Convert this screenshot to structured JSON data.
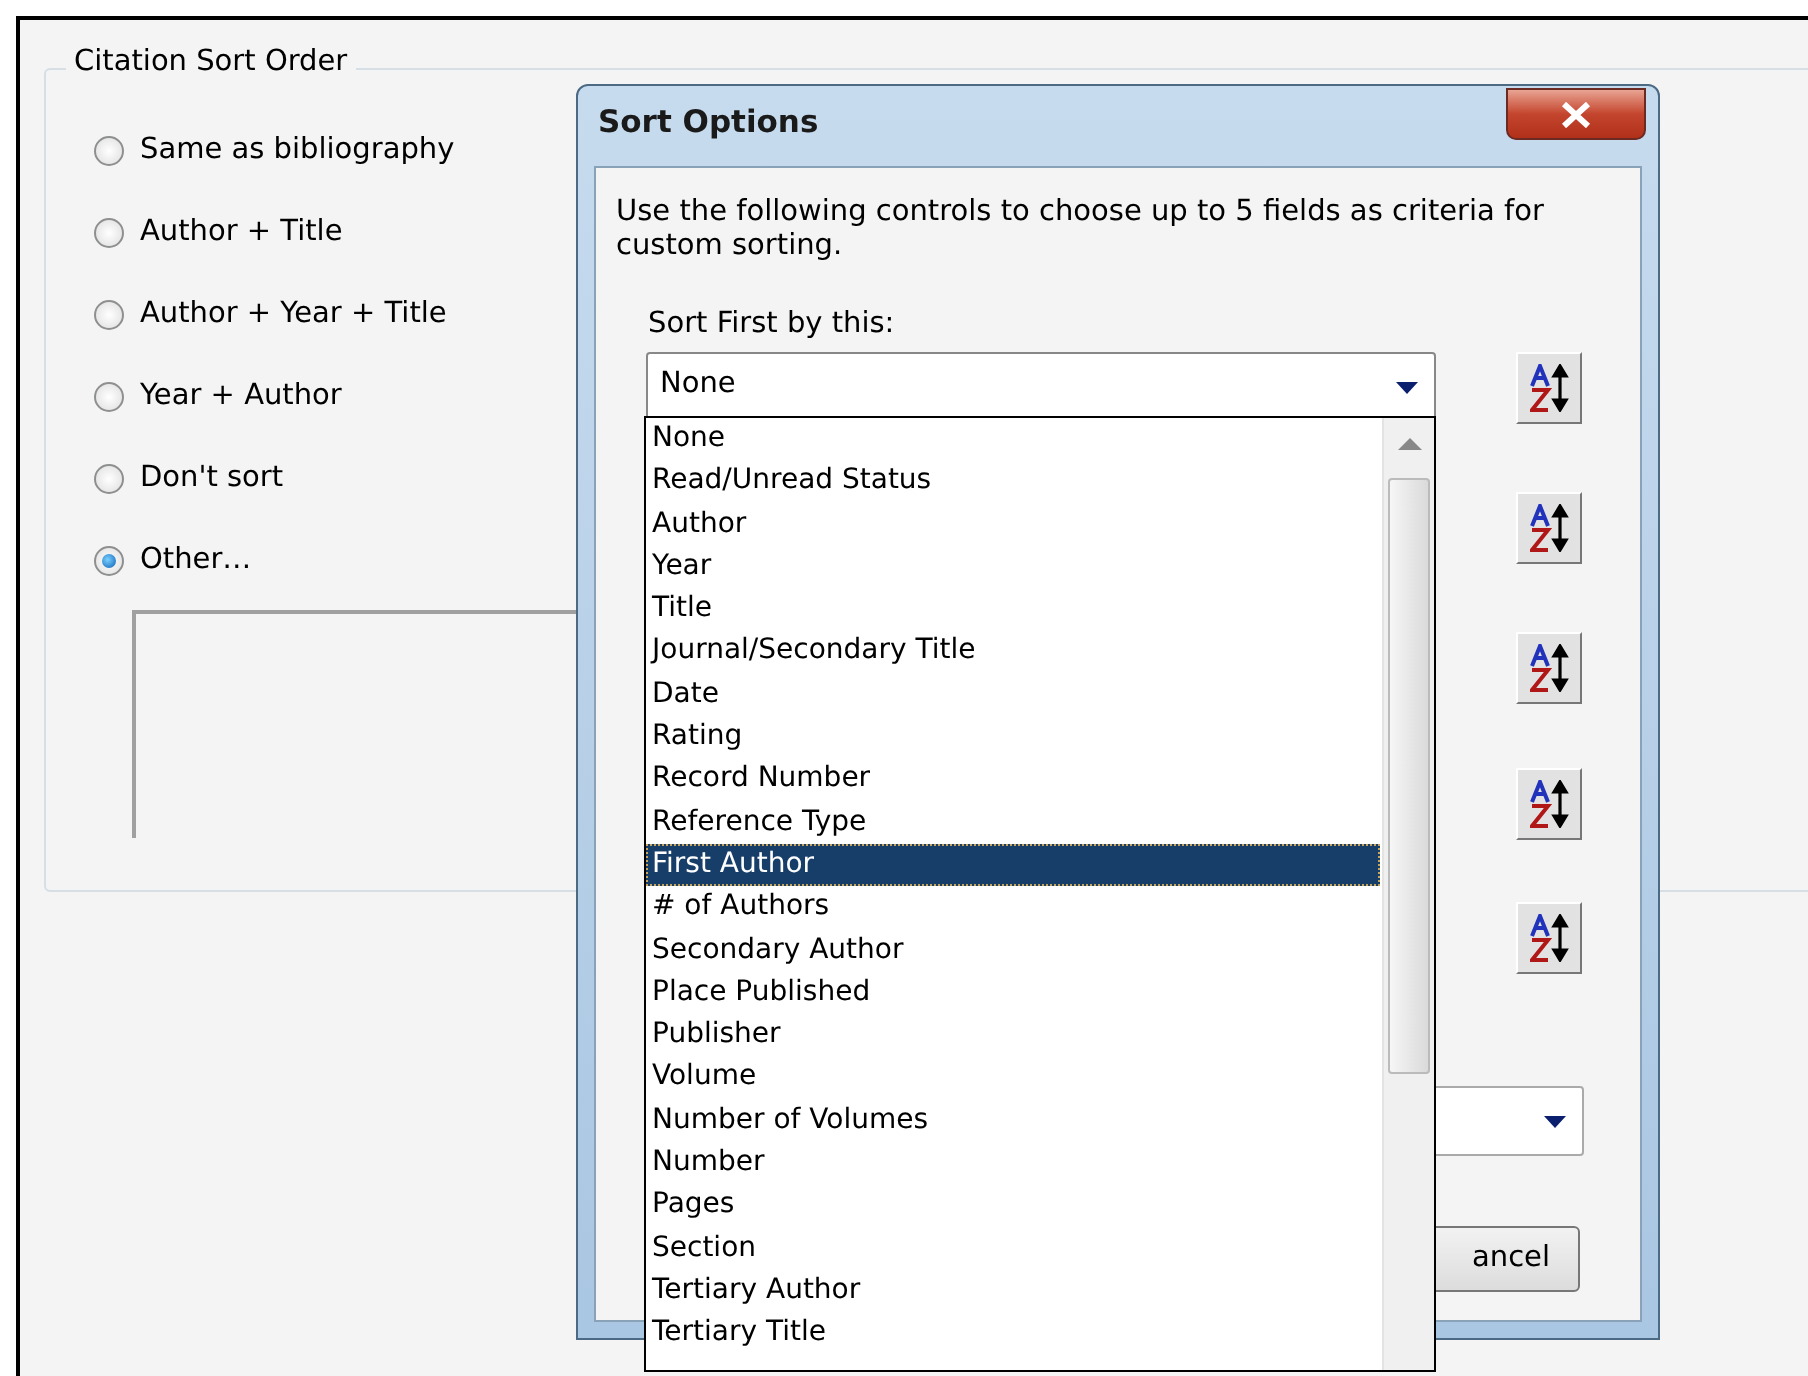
{
  "group": {
    "title": "Citation Sort Order",
    "options": [
      {
        "label": "Same as bibliography",
        "selected": false
      },
      {
        "label": "Author + Title",
        "selected": false
      },
      {
        "label": "Author + Year + Title",
        "selected": false
      },
      {
        "label": "Year + Author",
        "selected": false
      },
      {
        "label": "Don't sort",
        "selected": false
      },
      {
        "label": "Other…",
        "selected": true
      }
    ]
  },
  "dialog": {
    "title": "Sort Options",
    "instructions": "Use the following controls to choose up to 5 fields as criteria for custom sorting.",
    "first_label": "Sort First by this:",
    "first_value": "None",
    "sort_buttons": [
      {
        "kind": "az"
      },
      {
        "kind": "az"
      },
      {
        "kind": "az"
      },
      {
        "kind": "az"
      },
      {
        "kind": "az"
      }
    ],
    "cancel_button": "ancel",
    "dropdown": {
      "items": [
        {
          "label": "None",
          "selected": false
        },
        {
          "label": "Read/Unread Status",
          "selected": false
        },
        {
          "label": "Author",
          "selected": false
        },
        {
          "label": "Year",
          "selected": false
        },
        {
          "label": "Title",
          "selected": false
        },
        {
          "label": "Journal/Secondary Title",
          "selected": false
        },
        {
          "label": "Date",
          "selected": false
        },
        {
          "label": "Rating",
          "selected": false
        },
        {
          "label": "Record Number",
          "selected": false
        },
        {
          "label": "Reference Type",
          "selected": false
        },
        {
          "label": "First Author",
          "selected": true
        },
        {
          "label": "# of Authors",
          "selected": false
        },
        {
          "label": "Secondary Author",
          "selected": false
        },
        {
          "label": "Place Published",
          "selected": false
        },
        {
          "label": "Publisher",
          "selected": false
        },
        {
          "label": "Volume",
          "selected": false
        },
        {
          "label": "Number of Volumes",
          "selected": false
        },
        {
          "label": "Number",
          "selected": false
        },
        {
          "label": "Pages",
          "selected": false
        },
        {
          "label": "Section",
          "selected": false
        },
        {
          "label": "Tertiary Author",
          "selected": false
        },
        {
          "label": "Tertiary Title",
          "selected": false
        }
      ]
    }
  }
}
